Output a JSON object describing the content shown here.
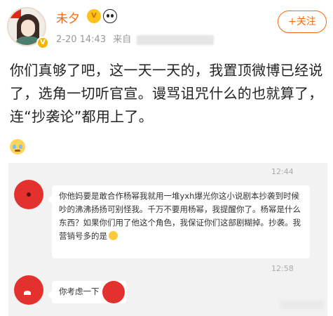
{
  "post": {
    "username": "未夕",
    "level_badge": "V",
    "timestamp": "2-20 14:43",
    "source_prefix": "来自",
    "follow_label": "+关注",
    "text": "你们真够了吧，这一天一天的，我置顶微博已经说了，选角一切听官宣。谩骂诅咒什么的也就算了，连“抄袭论”都用上了。",
    "emoji": "crying-face",
    "colors": {
      "username": "#f86a09",
      "follow_border": "#f86a09",
      "text": "#222222",
      "meta": "#999999"
    }
  },
  "chat_screenshot": {
    "messages": [
      {
        "time": "12:44",
        "text": "你他妈要是敢合作杨幂我就用一堆yxh爆光你这小说剧本抄袭到时候吵的沸沸扬扬可别怪我。千万不要用杨幂，我提醒你了。杨幂是什么东西？如果你们用了他这个角色，我保证你们这部剧糊掉。抄袭。我营销号多的是"
      },
      {
        "time": "12:58",
        "text": "你考虑一下"
      }
    ]
  }
}
